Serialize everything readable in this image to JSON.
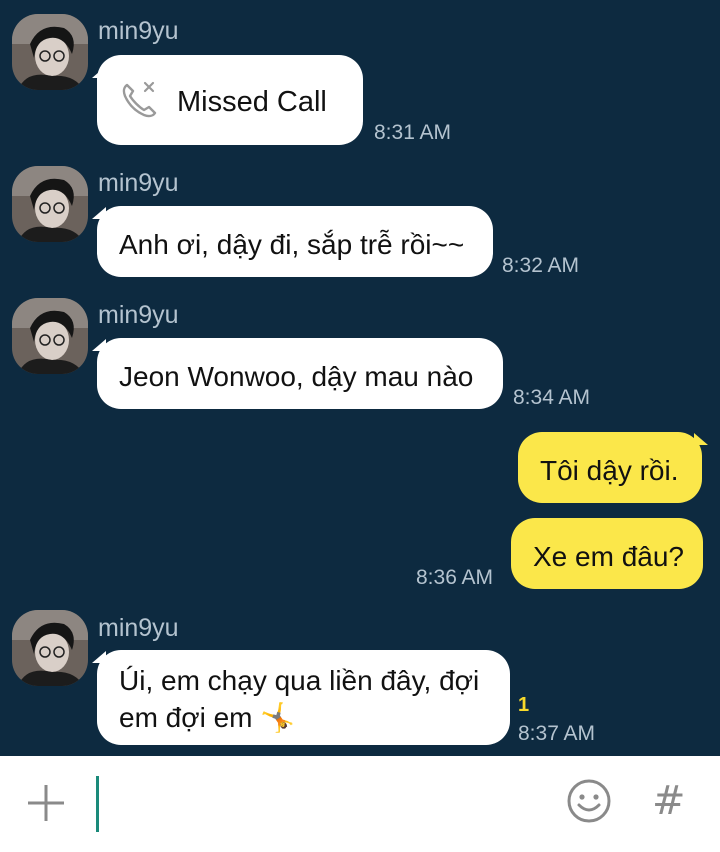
{
  "messages": [
    {
      "sender": "min9yu",
      "type": "missed_call",
      "text": "Missed Call",
      "time": "8:31 AM"
    },
    {
      "sender": "min9yu",
      "text": "Anh ơi, dậy đi, sắp trễ rồi~~",
      "time": "8:32 AM"
    },
    {
      "sender": "min9yu",
      "text": "Jeon Wonwoo, dậy mau nào",
      "time": "8:34 AM"
    },
    {
      "sender": "me",
      "text": "Tôi dậy rồi."
    },
    {
      "sender": "me",
      "text": "Xe em đâu?",
      "time": "8:36 AM"
    },
    {
      "sender": "min9yu",
      "text_line1": "Úi, em chạy qua liền đây, đợi",
      "text_line2": "em đợi em",
      "emoji": "🤸",
      "unread": "1",
      "time": "8:37 AM"
    }
  ],
  "input": {
    "placeholder": "",
    "value": ""
  },
  "icons": {
    "plus": "plus-icon",
    "emoji": "smiley-icon",
    "hash": "hash-icon",
    "missed_call": "missed-call-icon",
    "avatar": "avatar-image"
  },
  "colors": {
    "background": "#0d2a40",
    "incoming_bubble": "#ffffff",
    "outgoing_bubble": "#fbe74a",
    "timestamp": "#b4c3cf",
    "unread": "#f7d92b",
    "cursor": "#1a8a7a"
  }
}
